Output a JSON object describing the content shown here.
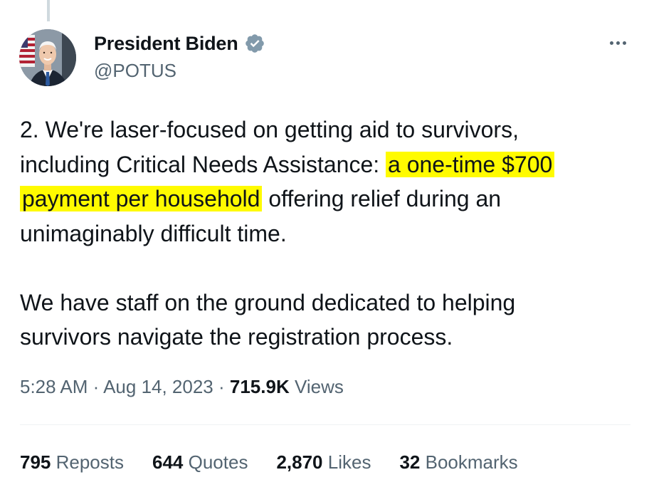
{
  "author": {
    "display_name": "President Biden",
    "handle": "@POTUS",
    "verified_color": "#829aab"
  },
  "tweet": {
    "line_1": "2. We're laser-focused on getting aid to survivors,",
    "line_2_plain": "including Critical Needs Assistance: ",
    "line_2_highlight": "a one-time $700",
    "line_3_highlight": "payment per household",
    "line_3_plain": " offering relief during an",
    "line_4": "unimaginably difficult time.",
    "line_5": "We have staff on the ground dedicated to helping",
    "line_6": "survivors navigate the registration process.",
    "highlight_color": "#fffb00"
  },
  "meta": {
    "time": "5:28 AM",
    "sep1": " · ",
    "date": "Aug 14, 2023",
    "sep2": " · ",
    "views_count": "715.9K",
    "views_label": " Views"
  },
  "stats": {
    "reposts_count": "795",
    "reposts_label": " Reposts",
    "quotes_count": "644",
    "quotes_label": " Quotes",
    "likes_count": "2,870",
    "likes_label": " Likes",
    "bookmarks_count": "32",
    "bookmarks_label": " Bookmarks"
  }
}
